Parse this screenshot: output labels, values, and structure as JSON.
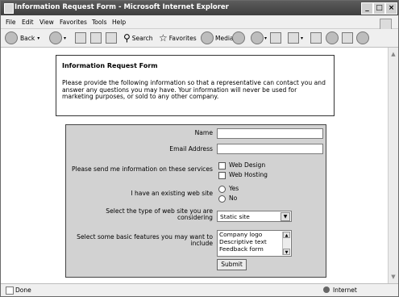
{
  "window": {
    "title": "Information Request Form - Microsoft Internet Explorer",
    "minimize": "_",
    "maximize": "□",
    "close": "×"
  },
  "menu": [
    "File",
    "Edit",
    "View",
    "Favorites",
    "Tools",
    "Help"
  ],
  "toolbar": {
    "back": "Back",
    "search": "Search",
    "favorites": "Favorites",
    "media": "Media"
  },
  "status": {
    "left": "Done",
    "right": "Internet"
  },
  "intro": {
    "heading": "Information Request Form",
    "text": "Please provide the following information so that a representative can contact you and answer any questions you may have. Your information will never be used for marketing purposes, or sold to any other company."
  },
  "form": {
    "name_label": "Name",
    "name_value": "",
    "email_label": "Email Address",
    "email_value": "",
    "services_label": "Please send me information on these services",
    "services": [
      "Web Design",
      "Web Hosting"
    ],
    "existing_label": "I have an existing web site",
    "existing_options": [
      "Yes",
      "No"
    ],
    "type_label_1": "Select the type of web site you are",
    "type_label_2": "considering",
    "type_selected": "Static site",
    "features_label_1": "Select some basic features you may want to",
    "features_label_2": "include",
    "features": [
      "Company logo",
      "Descriptive text",
      "Feedback form"
    ],
    "submit": "Submit"
  }
}
